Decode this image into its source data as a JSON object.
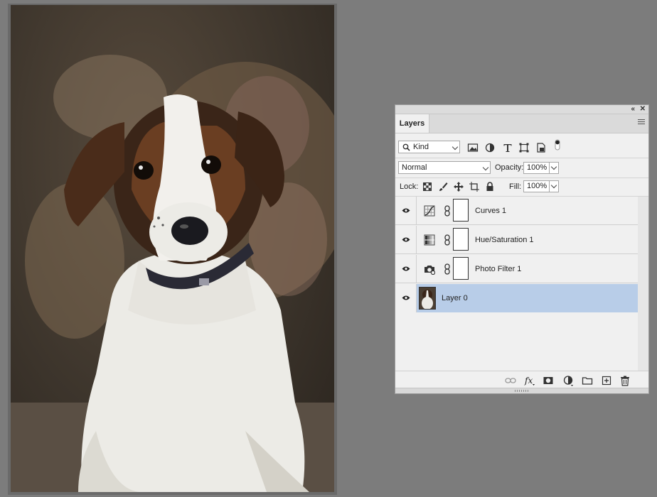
{
  "panel": {
    "collapse_icon": "double-chevron-left-icon",
    "close_icon": "close-icon",
    "tab_label": "Layers",
    "menu_icon": "hamburger-menu-icon"
  },
  "filter": {
    "kind_label": "Kind",
    "icons": [
      "search-icon",
      "pixel-filter-icon",
      "adjustment-filter-icon",
      "type-filter-icon",
      "shape-filter-icon",
      "smart-object-filter-icon",
      "filter-toggle-icon"
    ]
  },
  "blend": {
    "mode": "Normal",
    "opacity_label": "Opacity:",
    "opacity_value": "100%"
  },
  "lock": {
    "label": "Lock:",
    "fill_label": "Fill:",
    "fill_value": "100%"
  },
  "layers": [
    {
      "name": "Curves 1",
      "type": "curves",
      "visible": true,
      "selected": false
    },
    {
      "name": "Hue/Saturation 1",
      "type": "hue-saturation",
      "visible": true,
      "selected": false
    },
    {
      "name": "Photo Filter 1",
      "type": "photo-filter",
      "visible": true,
      "selected": false
    },
    {
      "name": "Layer 0",
      "type": "pixel",
      "visible": true,
      "selected": true
    }
  ],
  "bottom_actions": [
    "link-layers-icon",
    "fx-icon",
    "add-mask-icon",
    "new-adjustment-icon",
    "new-group-icon",
    "new-layer-icon",
    "trash-icon"
  ],
  "colors": {
    "workspace": "#7c7c7c",
    "panel": "#f0f0f0",
    "selection": "#b8cde8"
  }
}
